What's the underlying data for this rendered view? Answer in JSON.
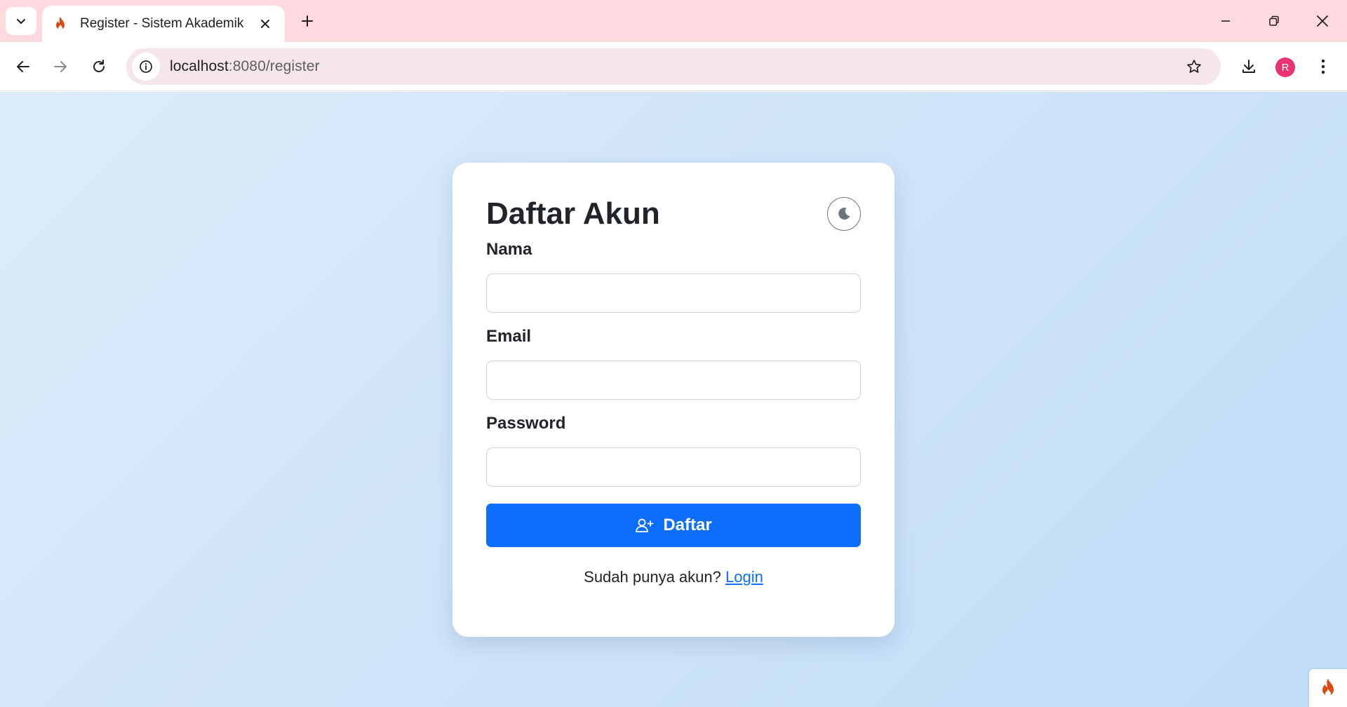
{
  "browser": {
    "tab": {
      "title": "Register - Sistem Akademik",
      "favicon": "flame-icon"
    },
    "url": {
      "host": "localhost",
      "path": ":8080/register"
    },
    "profile_initial": "R",
    "colors": {
      "tabstrip": "#ffd9e0",
      "omnibox": "#f5e6ea",
      "avatar": "#e8336f"
    }
  },
  "register": {
    "title": "Daftar Akun",
    "theme_toggle_icon": "moon-icon",
    "fields": {
      "name_label": "Nama",
      "name_value": "",
      "email_label": "Email",
      "email_value": "",
      "password_label": "Password",
      "password_value": ""
    },
    "submit_label": "Daftar",
    "submit_icon": "person-add-icon",
    "footer_prompt": "Sudah punya akun?",
    "footer_link": "Login"
  },
  "colors": {
    "primary": "#0d6efd",
    "card": "#ffffff",
    "background": "#cfe4f8"
  }
}
